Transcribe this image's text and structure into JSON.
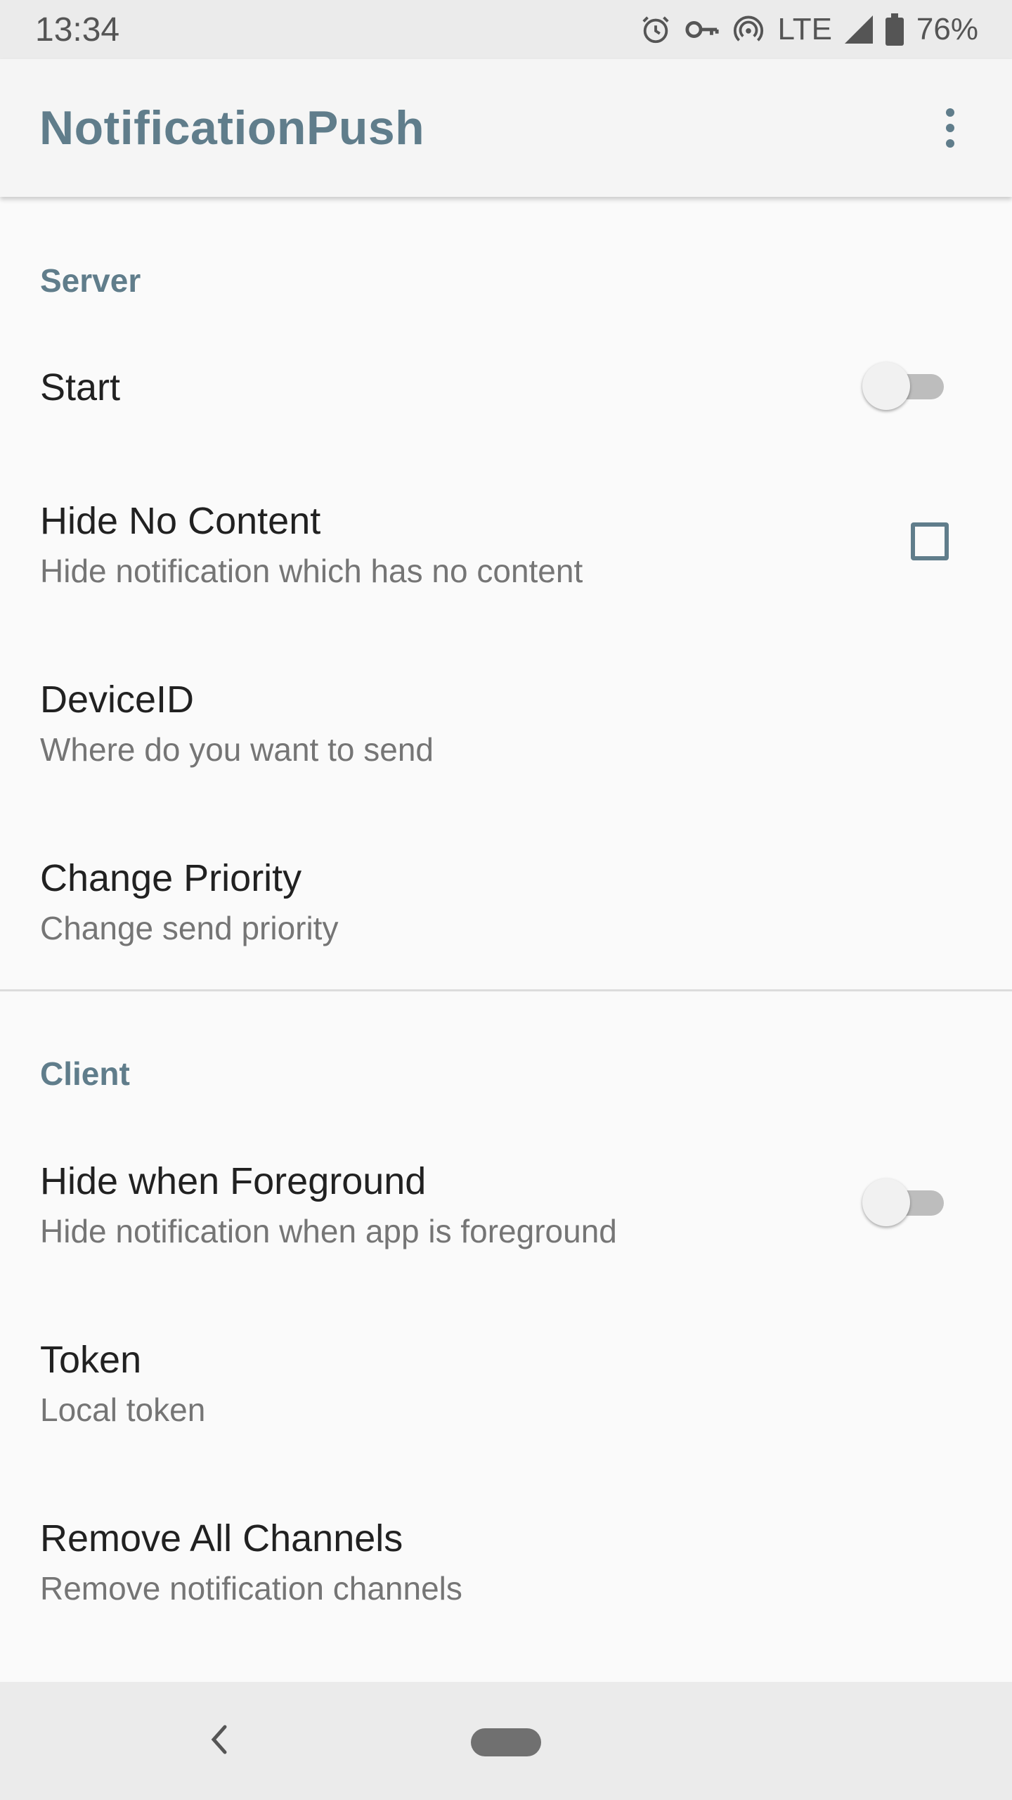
{
  "status_bar": {
    "time": "13:34",
    "network": "LTE",
    "battery": "76%",
    "icons": [
      "alarm-icon",
      "vpn-key-icon",
      "hotspot-icon",
      "signal-icon",
      "battery-icon"
    ]
  },
  "app_bar": {
    "title": "NotificationPush",
    "menu_icon": "more-vert-icon"
  },
  "categories": {
    "server": "Server",
    "client": "Client"
  },
  "server": {
    "start": {
      "title": "Start",
      "enabled": false
    },
    "hide_no_content": {
      "title": "Hide No Content",
      "summary": "Hide notification which has no content",
      "checked": false
    },
    "device_id": {
      "title": "DeviceID",
      "summary": "Where do you want to send"
    },
    "change_priority": {
      "title": "Change Priority",
      "summary": "Change send priority"
    }
  },
  "client": {
    "hide_when_foreground": {
      "title": "Hide when Foreground",
      "summary": "Hide notification when app is foreground",
      "enabled": false
    },
    "token": {
      "title": "Token",
      "summary": "Local token"
    },
    "remove_all_channels": {
      "title": "Remove All Channels",
      "summary": "Remove notification channels"
    }
  },
  "colors": {
    "accent": "#607d8b",
    "background": "#fafafa",
    "text_primary": "#212121",
    "text_secondary": "#757575"
  },
  "nav_bar": {
    "icons": [
      "back-icon",
      "home-pill-icon"
    ]
  }
}
